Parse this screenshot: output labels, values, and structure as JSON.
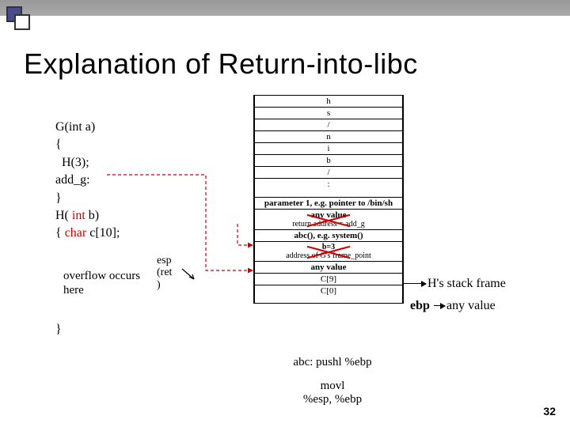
{
  "title": "Explanation of Return-into-libc",
  "code": {
    "l1": "G(int a)",
    "l2": "{",
    "l3": "  H(3);",
    "l4": "add_g:",
    "l5": "}",
    "l6": "H( ",
    "l6_kw": "int",
    "l6_b": " b)",
    "l7": "{ ",
    "l7_kw": "char",
    "l7_b": " c[10];"
  },
  "subnote": {
    "l1": "overflow occurs",
    "l2": "here"
  },
  "ret_label": {
    "a": "esp",
    "b": "(ret",
    "c": ")"
  },
  "stack": {
    "r0": "h",
    "r1": "s",
    "r2": "/",
    "r3": "n",
    "r4": "i",
    "r5": "b",
    "r6": "/",
    "r7": ":",
    "r8": "parameter 1, e.g. pointer to /bin/sh",
    "r9a": "any value",
    "r9b": "return address = add_g",
    "r10": "abc(), e.g. system()",
    "r11a": "b=3",
    "r11b": "address of G's frame_point",
    "r12": "any value",
    "r13": "C[9]",
    "r14": "C[0]"
  },
  "right": {
    "frame": "H's stack frame",
    "anyval": "any value",
    "ebp": "ebp"
  },
  "closing_brace": "}",
  "below": {
    "abc": "abc: pushl %ebp",
    "mov1": "movl",
    "mov2": "%esp, %ebp"
  },
  "pagenum": "32"
}
